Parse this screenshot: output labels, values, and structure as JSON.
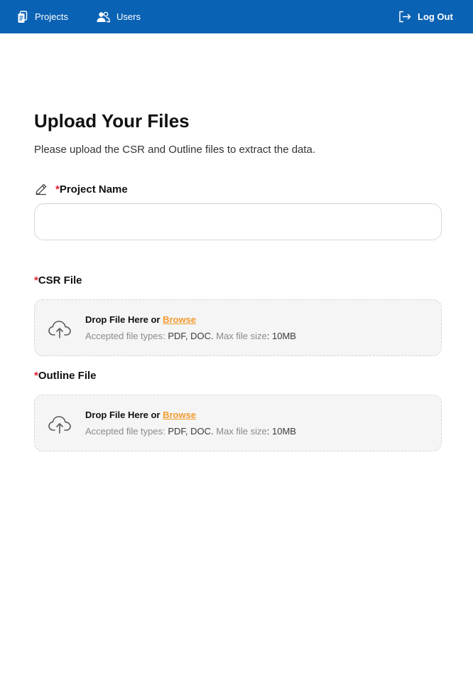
{
  "nav": {
    "projects_label": "Projects",
    "projects_icon": "document-icon",
    "users_label": "Users",
    "users_icon": "users-icon",
    "logout_label": "Log Out",
    "logout_icon": "logout-icon"
  },
  "colors": {
    "topbar": "#0a62b4",
    "required": "#e0202e",
    "browse": "#f29a2e",
    "dropzone_bg": "#f5f5f5"
  },
  "page": {
    "title": "Upload Your Files",
    "subtitle": "Please upload the CSR and Outline files to extract the data."
  },
  "form": {
    "required_mark": "*",
    "project_name": {
      "label": "Project Name",
      "icon": "pencil-icon",
      "value": "",
      "placeholder": ""
    },
    "csr_file": {
      "label": "CSR File",
      "drop_text": "Drop File Here or ",
      "browse_label": "Browse",
      "types_prefix": "Accepted file types: ",
      "types_value": "PDF, DOC.",
      "size_prefix": " Max file size",
      "size_value": ": 10MB",
      "icon": "cloud-upload-icon"
    },
    "outline_file": {
      "label": "Outline File",
      "drop_text": "Drop File Here or ",
      "browse_label": "Browse",
      "types_prefix": "Accepted file types: ",
      "types_value": "PDF, DOC.",
      "size_prefix": " Max file size",
      "size_value": ": 10MB",
      "icon": "cloud-upload-icon"
    }
  }
}
